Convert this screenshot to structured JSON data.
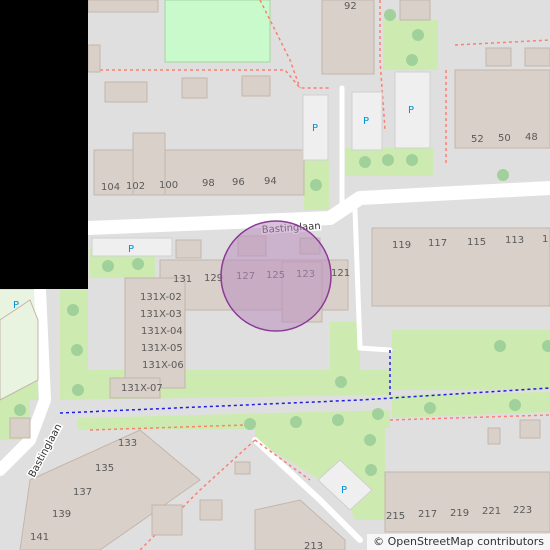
{
  "attribution": "© OpenStreetMap contributors",
  "street_names": [
    "Bastinglaan",
    "Bastinglaan"
  ],
  "parking_label": "P",
  "house_numbers": {
    "row_top": [
      "104",
      "102",
      "100",
      "98",
      "96",
      "94"
    ],
    "row_mid": [
      "131",
      "129",
      "127",
      "125",
      "123",
      "121"
    ],
    "annex": [
      "131X-02",
      "131X-03",
      "131X-04",
      "131X-05",
      "131X-06",
      "131X-07"
    ],
    "row_right": [
      "119",
      "117",
      "115",
      "113",
      "1"
    ],
    "row_far_right": [
      "52",
      "50",
      "48"
    ],
    "row_bottom_left": [
      "133",
      "135",
      "137",
      "139",
      "141"
    ],
    "row_bottom_right": [
      "215",
      "217",
      "219",
      "221",
      "223"
    ],
    "single": [
      "92",
      "213"
    ]
  },
  "colors": {
    "background": "#e0dfdf",
    "building": "#d9d0c9",
    "building_outline": "#c4b6ab",
    "park": "#c8facc",
    "grass": "#cdebb0",
    "road": "#ffffff",
    "footway_red": "#fa8072",
    "footway_blue": "#0000ff",
    "tree": "#a0d19b",
    "highlight_fill": "#b98ec0",
    "highlight_stroke": "#8b3a96",
    "parking_text": "#0092da"
  },
  "marker": {
    "shape": "circle",
    "label": "selected location"
  }
}
